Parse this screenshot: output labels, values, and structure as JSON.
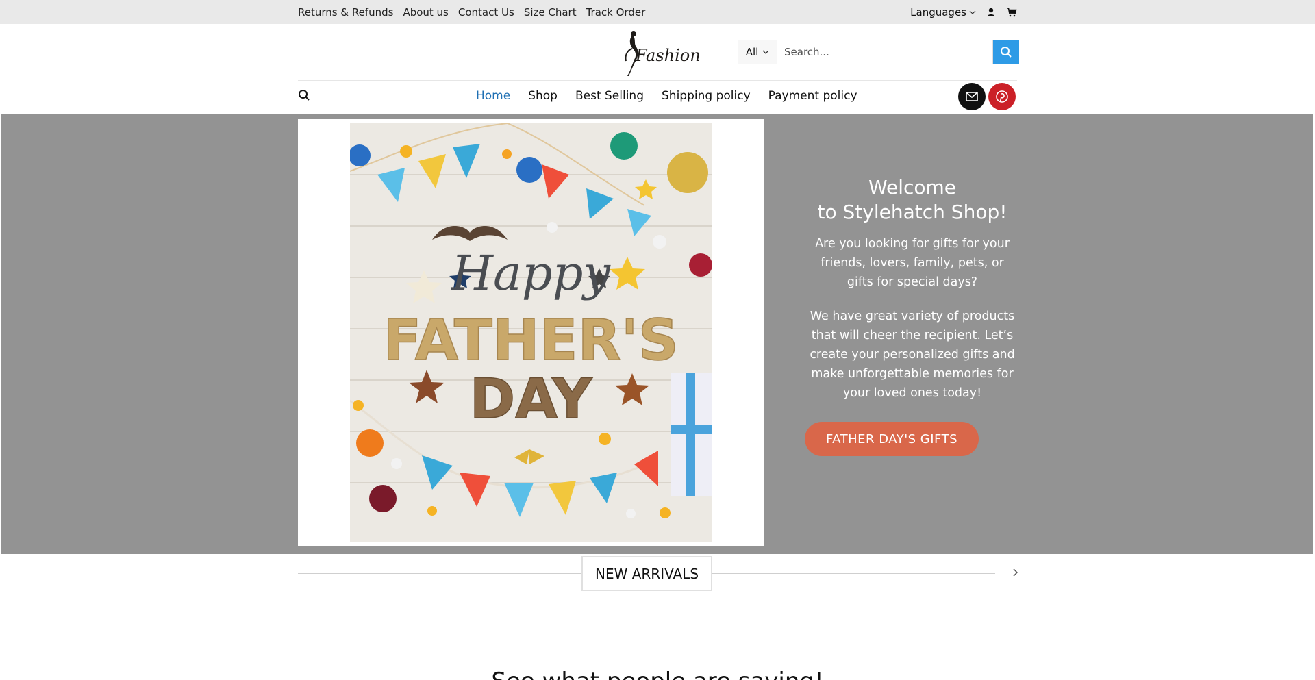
{
  "topbar": {
    "links": [
      "Returns & Refunds",
      "About us",
      "Contact Us",
      "Size Chart",
      "Track Order"
    ],
    "languages_label": "Languages",
    "icons": [
      "user-icon",
      "cart-icon"
    ]
  },
  "header": {
    "logo_text": "Fashion",
    "search": {
      "category": "All",
      "placeholder": "Search..."
    }
  },
  "nav": {
    "items": [
      "Home",
      "Shop",
      "Best Selling",
      "Shipping policy",
      "Payment policy"
    ],
    "active": "Home",
    "social_icons": [
      "mail-icon",
      "pinterest-icon"
    ]
  },
  "hero": {
    "image_text": {
      "line1": "Happy",
      "line2": "FATHER'S",
      "line3": "DAY"
    },
    "title_line1": "Welcome",
    "title_line2": "to Stylehatch Shop!",
    "paragraph1": "Are you looking for gifts for your friends, lovers, family, pets, or gifts for special days?",
    "paragraph2": "We have great variety of products that will cheer the recipient. Let’s create your personalized gifts and make unforgettable memories for your loved ones today!",
    "cta_label": "FATHER DAY'S GIFTS"
  },
  "arrivals": {
    "title": "NEW ARRIVALS"
  },
  "testimonials": {
    "title": "See what people are saying!"
  },
  "colors": {
    "accent_blue": "#2e9be6",
    "cta": "#d9674a",
    "hero_bg": "#939393",
    "active_nav": "#1e6fb3"
  }
}
